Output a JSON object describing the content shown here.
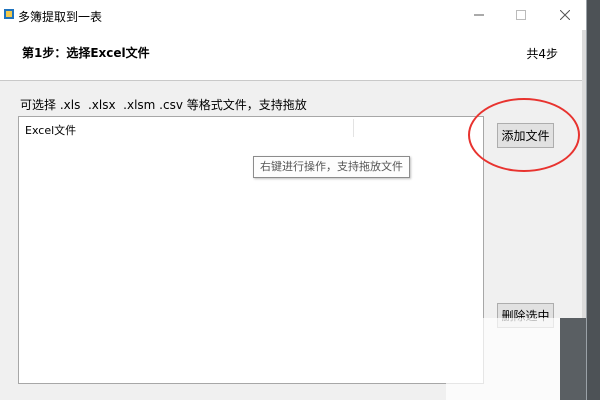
{
  "window": {
    "title": "多簿提取到一表",
    "controls": {
      "minimize": "minimize-icon",
      "maximize": "maximize-icon",
      "close": "close-icon"
    }
  },
  "header": {
    "step_title": "第1步：选择Excel文件",
    "step_count": "共4步"
  },
  "main": {
    "hint": "可选择 .xls  .xlsx  .xlsm .csv 等格式文件，支持拖放",
    "list_column": "Excel文件",
    "tooltip": "右键进行操作，支持拖放文件"
  },
  "buttons": {
    "add_label": "添加文件",
    "delete_label": "删除选中"
  },
  "colors": {
    "annotation": "#e8332f",
    "button_face": "#e1e1e1"
  }
}
